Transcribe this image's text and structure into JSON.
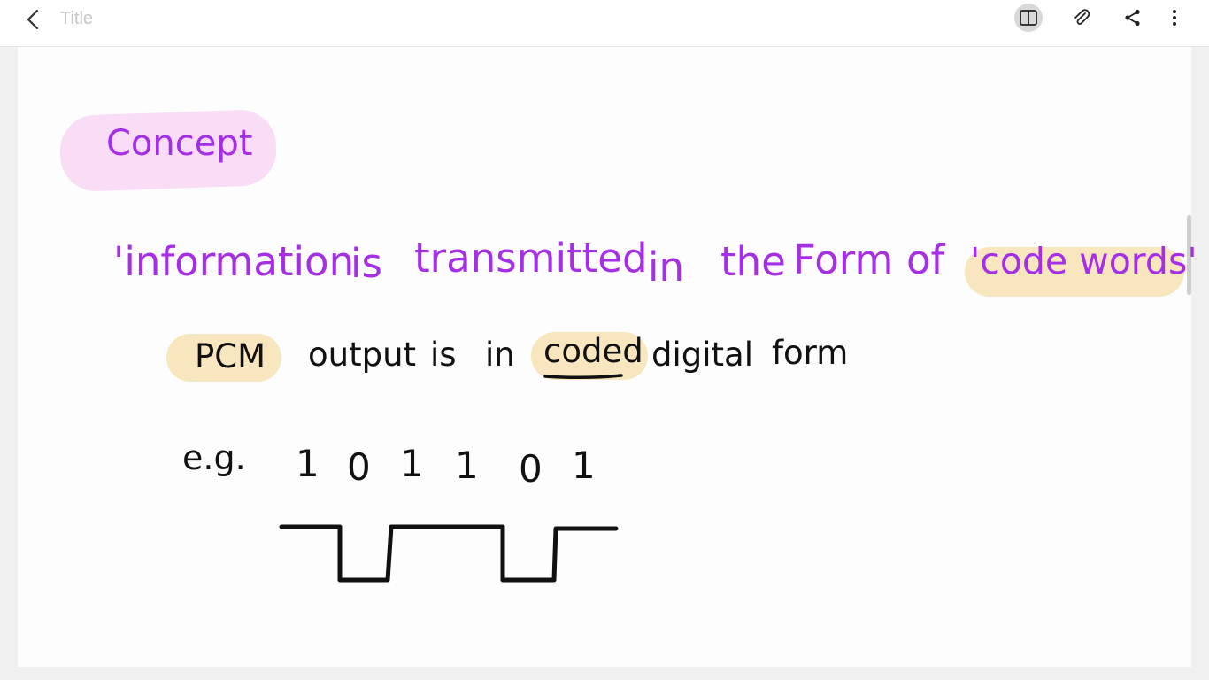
{
  "header": {
    "title": "Title",
    "back_icon": "chevron-left-icon",
    "icons": [
      "book-icon",
      "attachment-icon",
      "share-icon",
      "more-vertical-icon"
    ]
  },
  "note": {
    "heading": "Concept",
    "line1": {
      "part1": "'information",
      "part2": "is",
      "part3": "transmitted",
      "part4": "in",
      "part5": "the",
      "part6": "Form",
      "part7": "of",
      "highlight": "'code words'"
    },
    "line2": {
      "highlight1": "PCM",
      "text1": "output",
      "text2": "is",
      "text3": "in",
      "highlight2": "coded",
      "text4": "digital",
      "text5": "form"
    },
    "example": {
      "label": "e.g.",
      "bits": [
        "1",
        "0",
        "1",
        "1",
        "0",
        "1"
      ]
    }
  },
  "colors": {
    "purple_ink": "#a52ee6",
    "black_ink": "#111111",
    "pink_highlight": "#f9dcf6",
    "yellow_highlight": "#f8e6bf"
  }
}
